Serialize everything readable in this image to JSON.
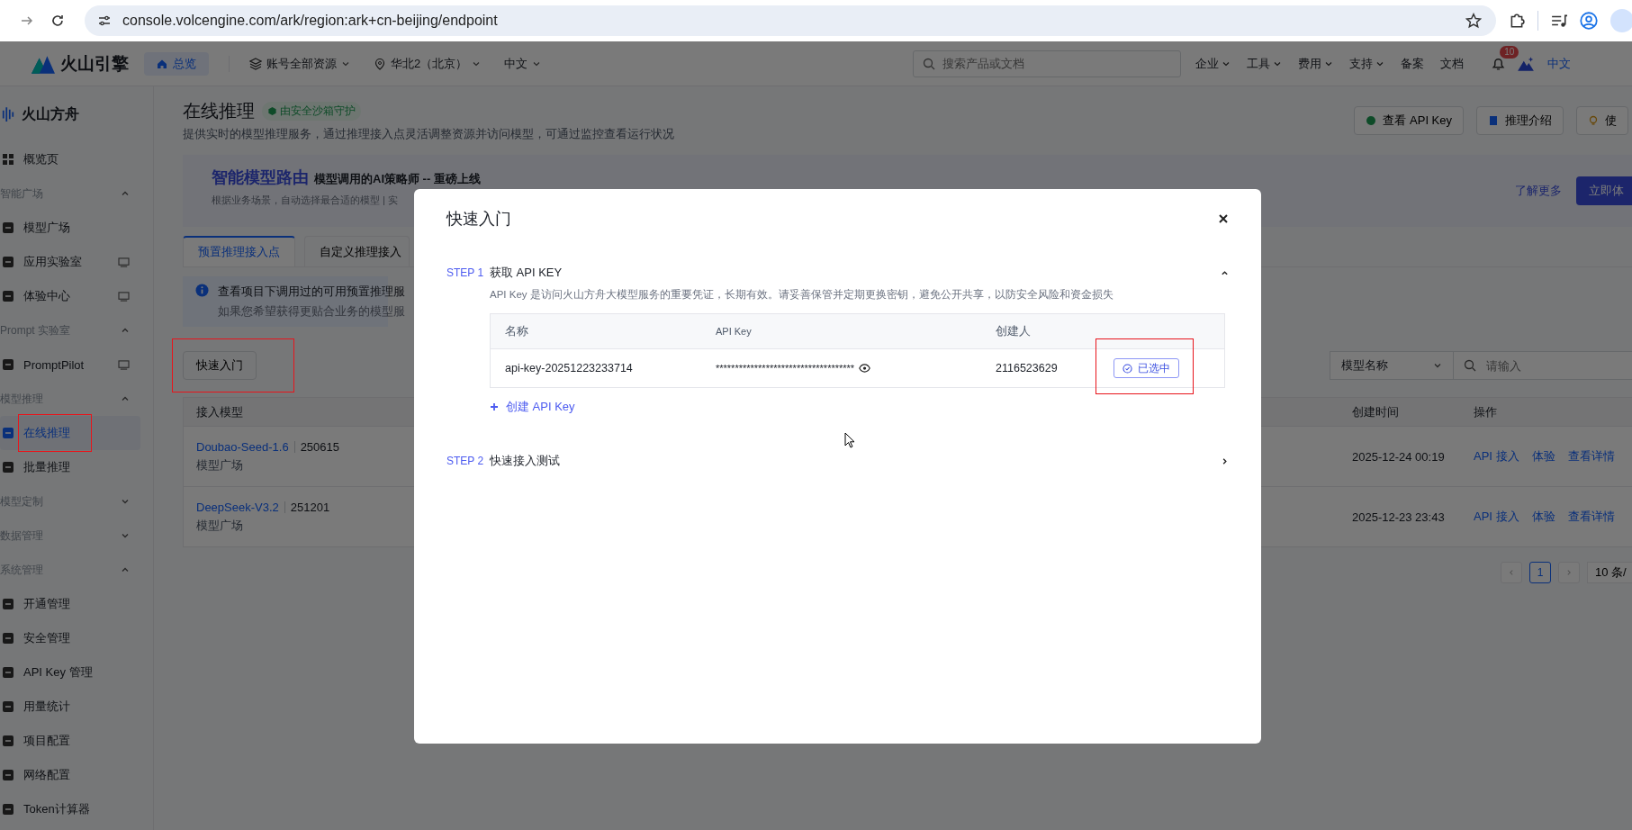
{
  "browser": {
    "url": "console.volcengine.com/ark/region:ark+cn-beijing/endpoint"
  },
  "top_nav": {
    "brand": "火山引擎",
    "home": "总览",
    "menus": [
      {
        "label": "账号全部资源",
        "kind": "layers"
      },
      {
        "label": "华北2（北京）",
        "kind": "location"
      },
      {
        "label": "中文",
        "kind": "plain"
      }
    ],
    "search": {
      "placeholder": "搜索产品或文档"
    },
    "links": [
      {
        "label": "企业",
        "dropdown": true
      },
      {
        "label": "工具",
        "dropdown": true
      },
      {
        "label": "费用",
        "dropdown": true
      },
      {
        "label": "支持",
        "dropdown": true
      },
      {
        "label": "备案",
        "dropdown": false
      },
      {
        "label": "文档",
        "dropdown": false
      }
    ],
    "notification_count": "10",
    "language": {
      "label": "中文",
      "selected": true
    }
  },
  "sidebar": {
    "product": "火山方舟",
    "items": [
      {
        "kind": "item",
        "label": "概览页",
        "selected": false
      },
      {
        "kind": "group",
        "label": "智能广场",
        "expanded": true,
        "children": [
          {
            "label": "模型广场",
            "selected": false,
            "trailing_icon": false
          },
          {
            "label": "应用实验室",
            "selected": false,
            "trailing_icon": true
          },
          {
            "label": "体验中心",
            "selected": false,
            "trailing_icon": true
          }
        ]
      },
      {
        "kind": "group",
        "label": "Prompt 实验室",
        "expanded": true,
        "children": [
          {
            "label": "PromptPilot",
            "selected": false,
            "trailing_icon": true
          }
        ]
      },
      {
        "kind": "group",
        "label": "模型推理",
        "expanded": true,
        "children": [
          {
            "label": "在线推理",
            "selected": true,
            "trailing_icon": false,
            "highlighted": true
          },
          {
            "label": "批量推理",
            "selected": false,
            "trailing_icon": false
          }
        ]
      },
      {
        "kind": "group",
        "label": "模型定制",
        "expanded": false
      },
      {
        "kind": "group",
        "label": "数据管理",
        "expanded": false
      },
      {
        "kind": "group",
        "label": "系统管理",
        "expanded": true,
        "children": [
          {
            "label": "开通管理",
            "selected": false,
            "trailing_icon": false
          },
          {
            "label": "安全管理",
            "selected": false,
            "trailing_icon": false
          },
          {
            "label": "API Key 管理",
            "selected": false,
            "trailing_icon": false
          },
          {
            "label": "用量统计",
            "selected": false,
            "trailing_icon": false
          },
          {
            "label": "项目配置",
            "selected": false,
            "trailing_icon": false
          },
          {
            "label": "网络配置",
            "selected": false,
            "trailing_icon": false
          },
          {
            "label": "Token计算器",
            "selected": false,
            "trailing_icon": false
          }
        ]
      }
    ]
  },
  "page": {
    "title": "在线推理",
    "badge": "由安全沙箱守护",
    "subtitle": "提供实时的模型推理服务，通过推理接入点灵活调整资源并访问模型，可通过监控查看运行状况",
    "header_buttons": [
      "查看 API Key",
      "推理介绍",
      "使"
    ],
    "banner": {
      "title": "智能模型路由",
      "headline": "模型调用的AI策略师 -- 重磅上线",
      "text": "根据业务场景，自动选择最合适的模型 | 实",
      "link": "了解更多",
      "cta": "立即体"
    },
    "tabs": [
      {
        "label": "预置推理接入点",
        "selected": true
      },
      {
        "label": "自定义推理接入",
        "selected": false
      }
    ],
    "info": [
      "查看项目下调用过的可用预置推理服",
      "如果您希望获得更贴合业务的模型服"
    ],
    "quick_start": {
      "label": "快速入门",
      "highlighted": true
    },
    "filter": {
      "field": "模型名称",
      "placeholder": "请输入"
    },
    "table": {
      "columns": [
        "接入模型",
        "创建时间",
        "操作"
      ],
      "rows": [
        {
          "model": "Doubao-Seed-1.6",
          "version": "250615",
          "source": "模型广场",
          "created": "2025-12-24 00:19",
          "actions": [
            "API 接入",
            "体验",
            "查看详情"
          ]
        },
        {
          "model": "DeepSeek-V3.2",
          "version": "251201",
          "source": "模型广场",
          "created": "2025-12-23 23:43",
          "actions": [
            "API 接入",
            "体验",
            "查看详情"
          ]
        }
      ]
    },
    "pagination": {
      "pages": [
        {
          "label": "1",
          "selected": true
        }
      ],
      "page_size": "10 条/"
    }
  },
  "modal": {
    "title": "快速入门",
    "steps": [
      {
        "label": "STEP 1",
        "title": "获取 API KEY",
        "expanded": true,
        "description": "API Key 是访问火山方舟大模型服务的重要凭证，长期有效。请妥善保管并定期更换密钥，避免公开共享，以防安全风险和资金损失",
        "table": {
          "columns": [
            "名称",
            "API Key",
            "创建人"
          ],
          "rows": [
            {
              "name": "api-key-20251223233714",
              "key": "************************************",
              "creator": "2116523629",
              "action": {
                "label": "已选中",
                "selected": true,
                "highlighted": true
              }
            }
          ]
        },
        "create_link": "创建 API Key"
      },
      {
        "label": "STEP 2",
        "title": "快速接入测试",
        "expanded": false
      }
    ]
  }
}
